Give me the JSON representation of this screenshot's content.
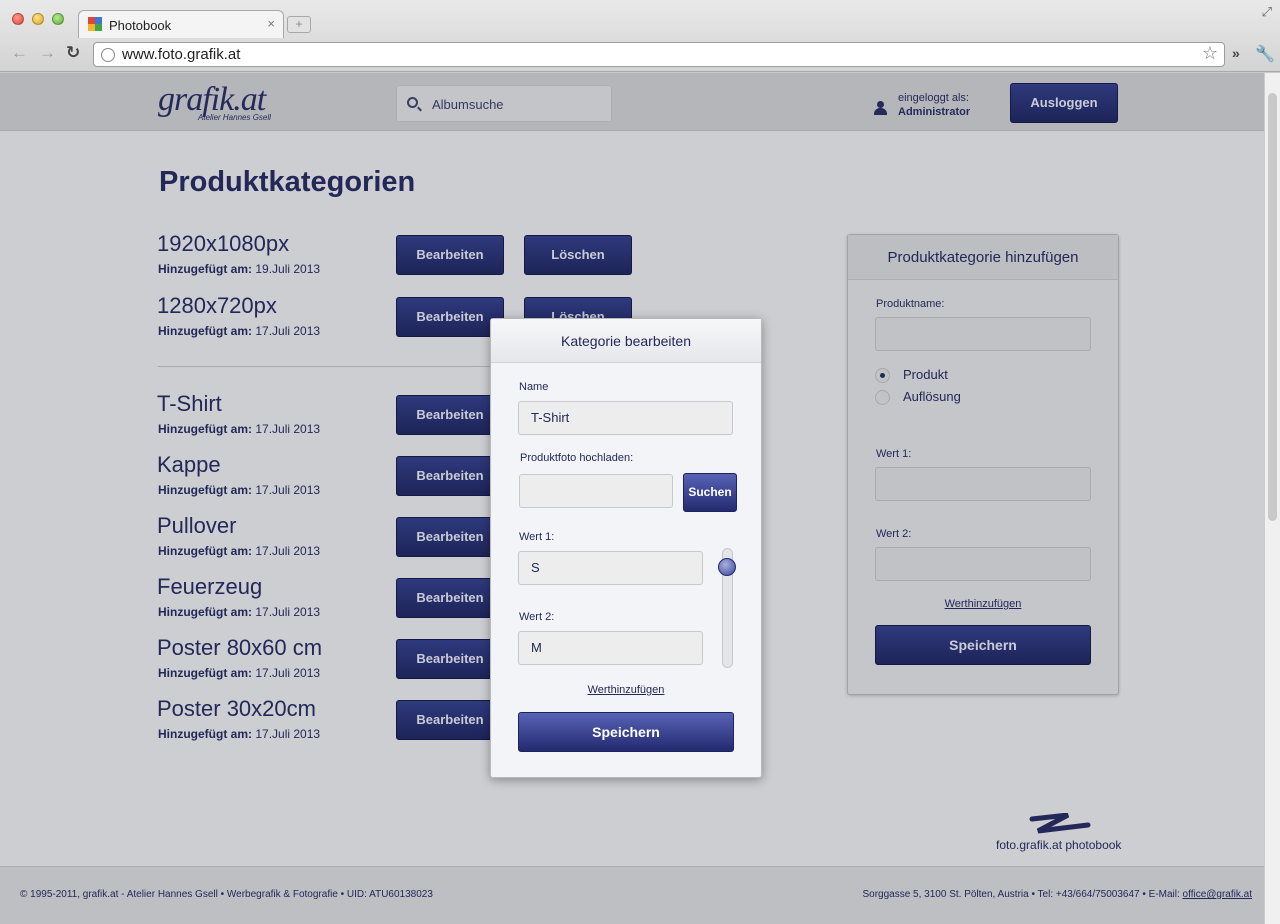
{
  "browser": {
    "tab_title": "Photobook",
    "tab_close": "×",
    "new_tab": "+",
    "url": "www.foto.grafik.at",
    "back": "←",
    "forward": "→",
    "reload": "↻",
    "bookmark": "☆",
    "extensions": "»",
    "menu": "🔧",
    "resize": "⤢"
  },
  "header": {
    "logo": "grafik.at",
    "logo_sub": "Atelier Hannes Gsell",
    "search_placeholder": "Albumsuche",
    "login_label": "eingeloggt als:",
    "login_user": "Administrator",
    "logout_label": "Ausloggen"
  },
  "main": {
    "title": "Produktkategorien",
    "added_label": "Hinzugefügt am:",
    "edit_label": "Bearbeiten",
    "delete_label": "Löschen",
    "categories": [
      {
        "name": "1920x1080px",
        "date": "19.Juli 2013"
      },
      {
        "name": "1280x720px",
        "date": "17.Juli 2013"
      },
      {
        "name": "T-Shirt",
        "date": "17.Juli 2013"
      },
      {
        "name": "Kappe",
        "date": "17.Juli 2013"
      },
      {
        "name": "Pullover",
        "date": "17.Juli 2013"
      },
      {
        "name": "Feuerzeug",
        "date": "17.Juli 2013"
      },
      {
        "name": "Poster 80x60 cm",
        "date": "17.Juli 2013"
      },
      {
        "name": "Poster 30x20cm",
        "date": "17.Juli 2013"
      }
    ]
  },
  "add_panel": {
    "title": "Produktkategorie hinzufügen",
    "name_label": "Produktname:",
    "radio_product": "Produkt",
    "radio_resolution": "Auflösung",
    "value1_label": "Wert 1:",
    "value2_label": "Wert 2:",
    "add_value_link": "Werthinzufügen",
    "save_label": "Speichern"
  },
  "modal": {
    "title": "Kategorie bearbeiten",
    "name_label": "Name",
    "name_value": "T-Shirt",
    "upload_label": "Produktfoto hochladen:",
    "search_button": "Suchen",
    "value1_label": "Wert 1:",
    "value1": "S",
    "value2_label": "Wert 2:",
    "value2": "M",
    "add_value_link": "Werthinzufügen",
    "save_label": "Speichern"
  },
  "brand": "foto.grafik.at photobook",
  "footer": {
    "left": "© 1995-2011, grafik.at - Atelier Hannes Gsell • Werbegrafik & Fotografie • UID: ATU60138023",
    "right_prefix": "Sorggasse 5, 3100 St. Pölten, Austria • Tel: +43/664/75003647 • E-Mail: ",
    "email": "office@grafik.at"
  }
}
